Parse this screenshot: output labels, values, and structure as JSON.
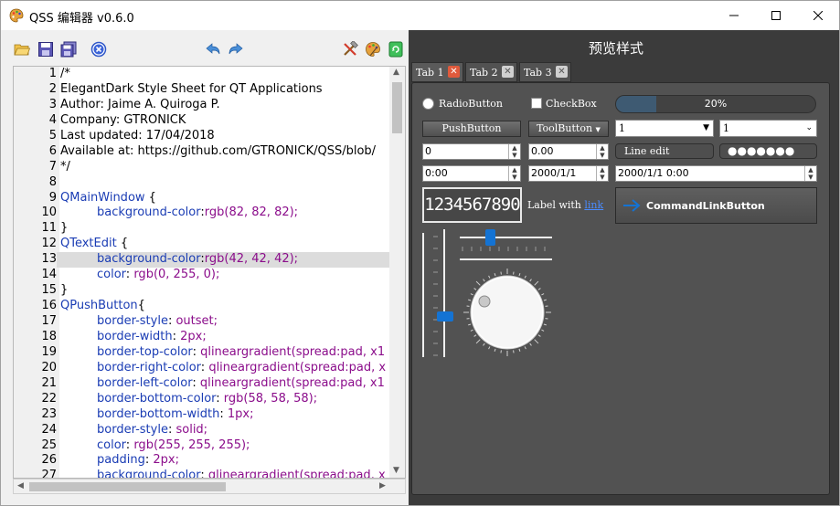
{
  "window": {
    "title": "QSS 编辑器 v0.6.0",
    "minimize_icon": "minimize-icon",
    "maximize_icon": "maximize-icon",
    "close_icon": "close-icon"
  },
  "toolbar": {
    "icons": [
      "open-folder-icon",
      "save-icon",
      "save-all-icon",
      "close-file-icon",
      "undo-icon",
      "redo-icon",
      "tools-icon",
      "palette-icon",
      "refresh-icon"
    ]
  },
  "editor": {
    "current_line": 13,
    "lines": [
      {
        "n": "1",
        "text": "/*"
      },
      {
        "n": "2",
        "text": "ElegantDark Style Sheet for QT Applications"
      },
      {
        "n": "3",
        "text": "Author: Jaime A. Quiroga P."
      },
      {
        "n": "4",
        "text": "Company: GTRONICK"
      },
      {
        "n": "5",
        "text": "Last updated: 17/04/2018"
      },
      {
        "n": "6",
        "text": "Available at: https://github.com/GTRONICK/QSS/blob/"
      },
      {
        "n": "7",
        "text": "*/"
      },
      {
        "n": "8",
        "text": ""
      },
      {
        "n": "9",
        "sel": "QMainWindow",
        "rest": " {"
      },
      {
        "n": "10",
        "prop": "background-color",
        "val": "rgb(82, 82, 82);"
      },
      {
        "n": "11",
        "text": "}"
      },
      {
        "n": "12",
        "sel": "QTextEdit",
        "rest": " {"
      },
      {
        "n": "13",
        "prop": "background-color",
        "val": "rgb(42, 42, 42);"
      },
      {
        "n": "14",
        "prop": "color",
        "val": " rgb(0, 255, 0);"
      },
      {
        "n": "15",
        "text": "}"
      },
      {
        "n": "16",
        "sel": "QPushButton",
        "rest": "{"
      },
      {
        "n": "17",
        "prop": "border-style",
        "val": " outset;"
      },
      {
        "n": "18",
        "prop": "border-width",
        "val": " 2px;"
      },
      {
        "n": "19",
        "prop": "border-top-color",
        "val": " qlineargradient(spread:pad, x1"
      },
      {
        "n": "20",
        "prop": "border-right-color",
        "val": " qlineargradient(spread:pad, x"
      },
      {
        "n": "21",
        "prop": "border-left-color",
        "val": " qlineargradient(spread:pad, x1"
      },
      {
        "n": "22",
        "prop": "border-bottom-color",
        "val": " rgb(58, 58, 58);"
      },
      {
        "n": "23",
        "prop": "border-bottom-width",
        "val": " 1px;"
      },
      {
        "n": "24",
        "prop": "border-style",
        "val": " solid;"
      },
      {
        "n": "25",
        "prop": "color",
        "val": " rgb(255, 255, 255);"
      },
      {
        "n": "26",
        "prop": "padding",
        "val": " 2px;"
      },
      {
        "n": "27",
        "prop": "background-color",
        "val": " qlineargradient(spread:pad, x"
      }
    ],
    "last_partial": "}"
  },
  "preview": {
    "title": "预览样式",
    "tabs": [
      {
        "label": "Tab 1",
        "active": true,
        "close_color": "#e05a3c"
      },
      {
        "label": "Tab 2",
        "active": false,
        "close_color": "#d0d0d0"
      },
      {
        "label": "Tab 3",
        "active": false,
        "close_color": "#d0d0d0"
      }
    ],
    "radio_label": "RadioButton",
    "checkbox_label": "CheckBox",
    "progress": {
      "value": 0.2,
      "text": "20%"
    },
    "push_button": "PushButton",
    "tool_button": "ToolButton",
    "combo1": "1",
    "combo2": "1",
    "spin1": "0",
    "spin2": "0.00",
    "line_edit": "Line edit",
    "password_dots": "●●●●●●●",
    "time_edit": "0:00",
    "date_edit": "2000/1/1",
    "datetime_edit": "2000/1/1 0:00",
    "lcd_value": "1234567890",
    "label_text": "Label with ",
    "link_text": "link",
    "command_link": "CommandLinkButton",
    "accent": "#1473d3"
  }
}
